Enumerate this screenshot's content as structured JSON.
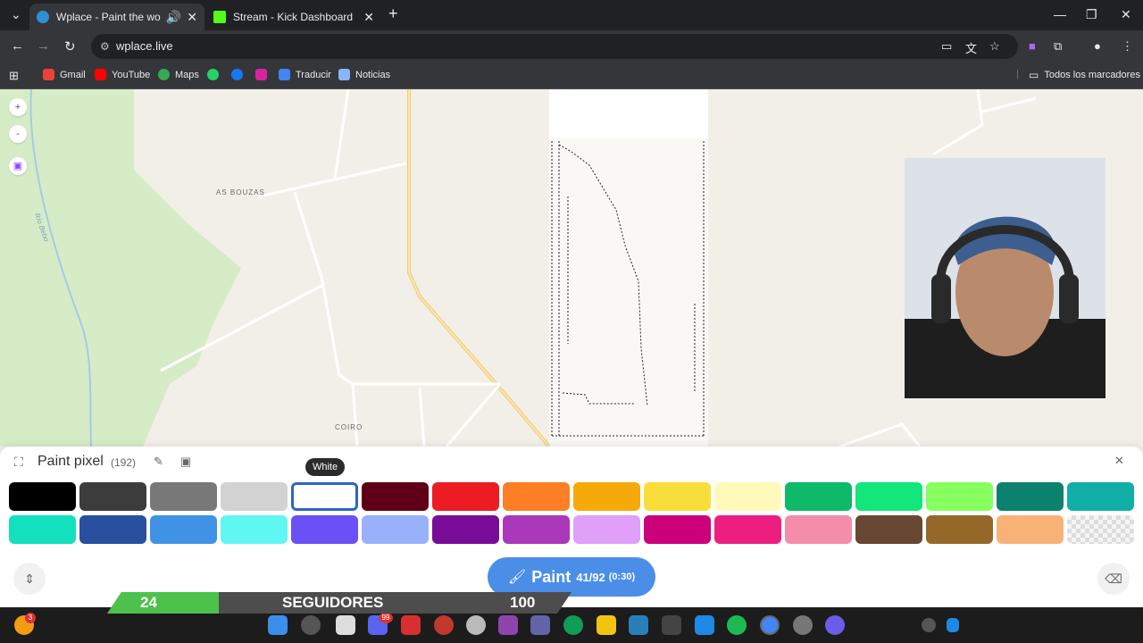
{
  "browser": {
    "tabs": [
      {
        "title": "Wplace - Paint the world",
        "active": true
      },
      {
        "title": "Stream - Kick Dashboard",
        "active": false
      }
    ],
    "url": "wplace.live",
    "bookmarks": [
      "Gmail",
      "YouTube",
      "Maps",
      "Traducir",
      "Noticias"
    ],
    "all_bookmarks": "Todos los marcadores"
  },
  "map": {
    "labels": {
      "as_bouzas": "AS BOUZAS",
      "coiro": "COIRO",
      "rio_bebo": "Río Bebo"
    },
    "zoom_in": "+",
    "zoom_out": "-"
  },
  "paint_panel": {
    "title": "Paint pixel",
    "count": "(192)",
    "tooltip": "White",
    "selected_color": "#ffffff",
    "palette_row1": [
      "#000000",
      "#3c3c3c",
      "#787878",
      "#d2d2d2",
      "#ffffff",
      "#600018",
      "#ed1c24",
      "#ff7f27",
      "#f6aa09",
      "#f9dd3b",
      "#fffabc",
      "#0eb968",
      "#13e67b",
      "#87ff5e",
      "#0c816e",
      "#10aea6"
    ],
    "palette_row2": [
      "#13e1be",
      "#28509e",
      "#4093e4",
      "#60f7f2",
      "#6b50f6",
      "#99b1fb",
      "#780c99",
      "#aa38b9",
      "#e09ff9",
      "#cb007a",
      "#ec1f80",
      "#f38da9",
      "#684634",
      "#95682a",
      "#f8b277",
      "transparent"
    ],
    "paint_button": {
      "label": "Paint",
      "count": "41/92",
      "timer": "(0:30)"
    }
  },
  "followers_overlay": {
    "current": "24",
    "label": "SEGUIDORES",
    "goal": "100",
    "progress_fraction": 0.24
  },
  "taskbar": {
    "badge_notifications": "3",
    "badge_discord": "99"
  }
}
